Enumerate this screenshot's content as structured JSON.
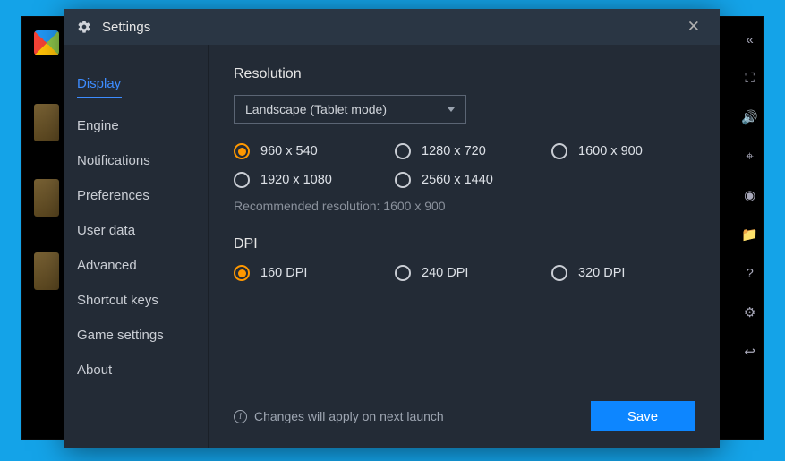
{
  "modal": {
    "title": "Settings",
    "close_label": "✕"
  },
  "sidebar": {
    "items": [
      {
        "label": "Display",
        "active": true
      },
      {
        "label": "Engine",
        "active": false
      },
      {
        "label": "Notifications",
        "active": false
      },
      {
        "label": "Preferences",
        "active": false
      },
      {
        "label": "User data",
        "active": false
      },
      {
        "label": "Advanced",
        "active": false
      },
      {
        "label": "Shortcut keys",
        "active": false
      },
      {
        "label": "Game settings",
        "active": false
      },
      {
        "label": "About",
        "active": false
      }
    ]
  },
  "content": {
    "resolution_title": "Resolution",
    "orientation_selected": "Landscape (Tablet mode)",
    "resolutions": [
      {
        "label": "960 x 540",
        "selected": true
      },
      {
        "label": "1280 x 720",
        "selected": false
      },
      {
        "label": "1600 x 900",
        "selected": false
      },
      {
        "label": "1920 x 1080",
        "selected": false
      },
      {
        "label": "2560 x 1440",
        "selected": false
      }
    ],
    "recommended_text": "Recommended resolution: 1600 x 900",
    "dpi_title": "DPI",
    "dpis": [
      {
        "label": "160 DPI",
        "selected": true
      },
      {
        "label": "240 DPI",
        "selected": false
      },
      {
        "label": "320 DPI",
        "selected": false
      }
    ],
    "info_text": "Changes will apply on next launch",
    "save_label": "Save"
  }
}
